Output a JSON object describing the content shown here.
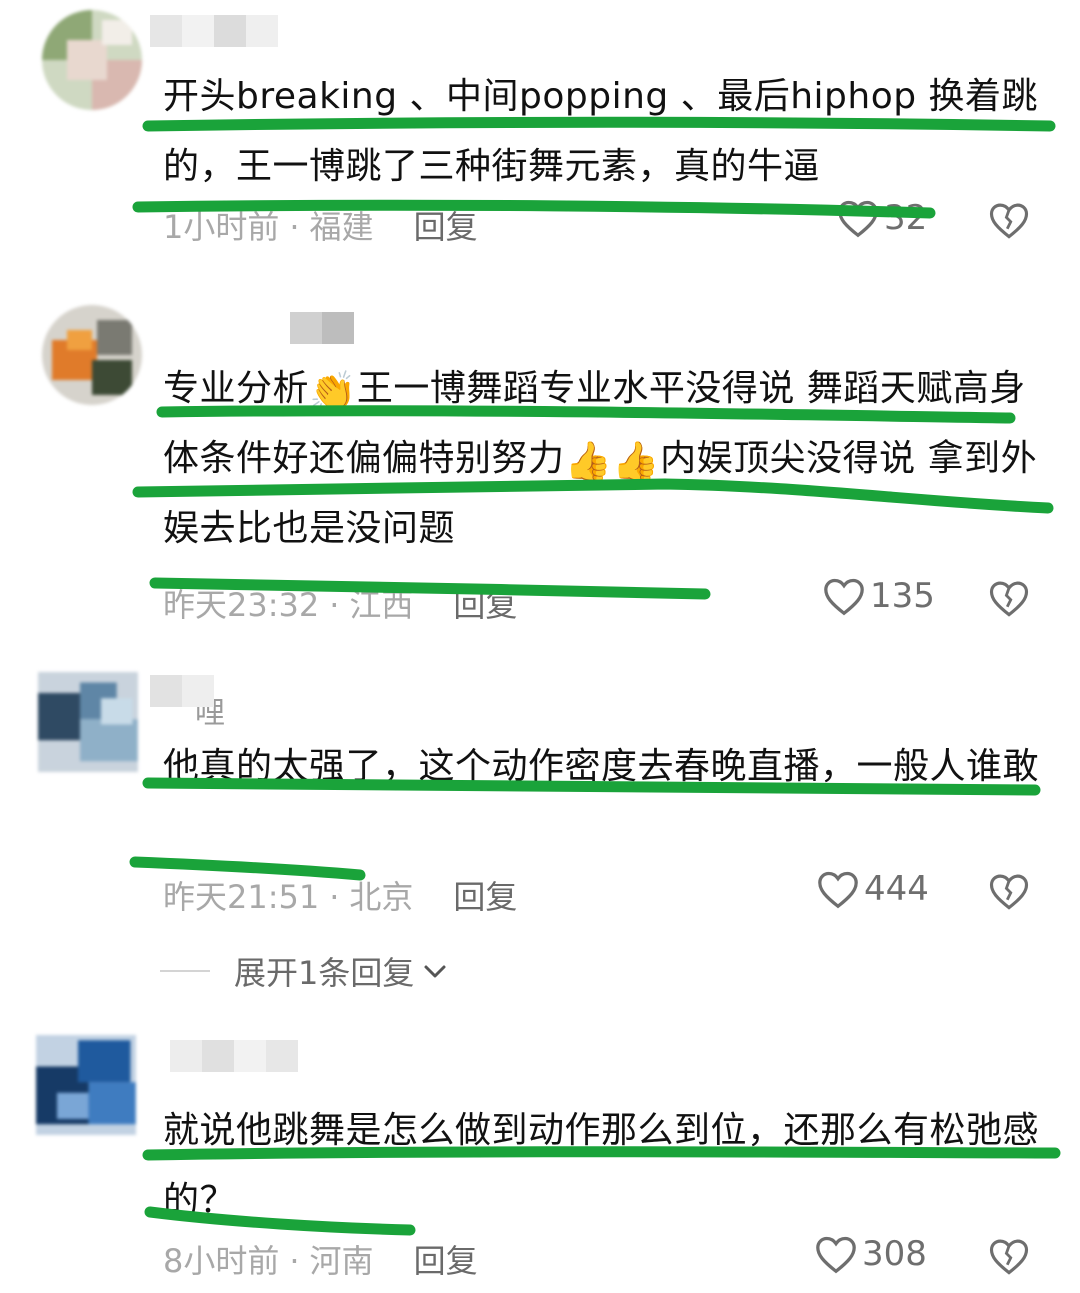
{
  "comments": [
    {
      "username": "",
      "text": "开头breaking 、中间popping 、最后hiphop 换着跳的，王一博跳了三种街舞元素，真的牛逼",
      "time": "1小时前",
      "location": "福建",
      "reply_label": "回复",
      "likes": "32"
    },
    {
      "username": "",
      "text_parts": [
        "专业分析",
        "👏",
        "王一博舞蹈专业水平没得说 舞蹈天赋高身体条件好还偏偏特别努力",
        "👍👍",
        "内娱顶尖没得说 拿到外娱去比也是没问题"
      ],
      "time": "昨天23:32",
      "location": "江西",
      "reply_label": "回复",
      "likes": "135"
    },
    {
      "username": "哩",
      "text": "他真的太强了，这个动作密度去春晚直播，一般人谁敢",
      "time": "昨天21:51",
      "location": "北京",
      "reply_label": "回复",
      "likes": "444",
      "expand_label": "展开1条回复"
    },
    {
      "username": "lacar",
      "text": "就说他跳舞是怎么做到动作那么到位，还那么有松弛感的？",
      "time": "8小时前",
      "location": "河南",
      "reply_label": "回复",
      "likes": "308"
    }
  ],
  "icons": {
    "like": "heart-outline-icon",
    "dislike": "broken-heart-icon",
    "expand": "chevron-down-icon"
  },
  "colors": {
    "highlight_marker": "#1aa33a",
    "meta_text": "#a8a8a8",
    "reply_text": "#6a6a6a"
  }
}
